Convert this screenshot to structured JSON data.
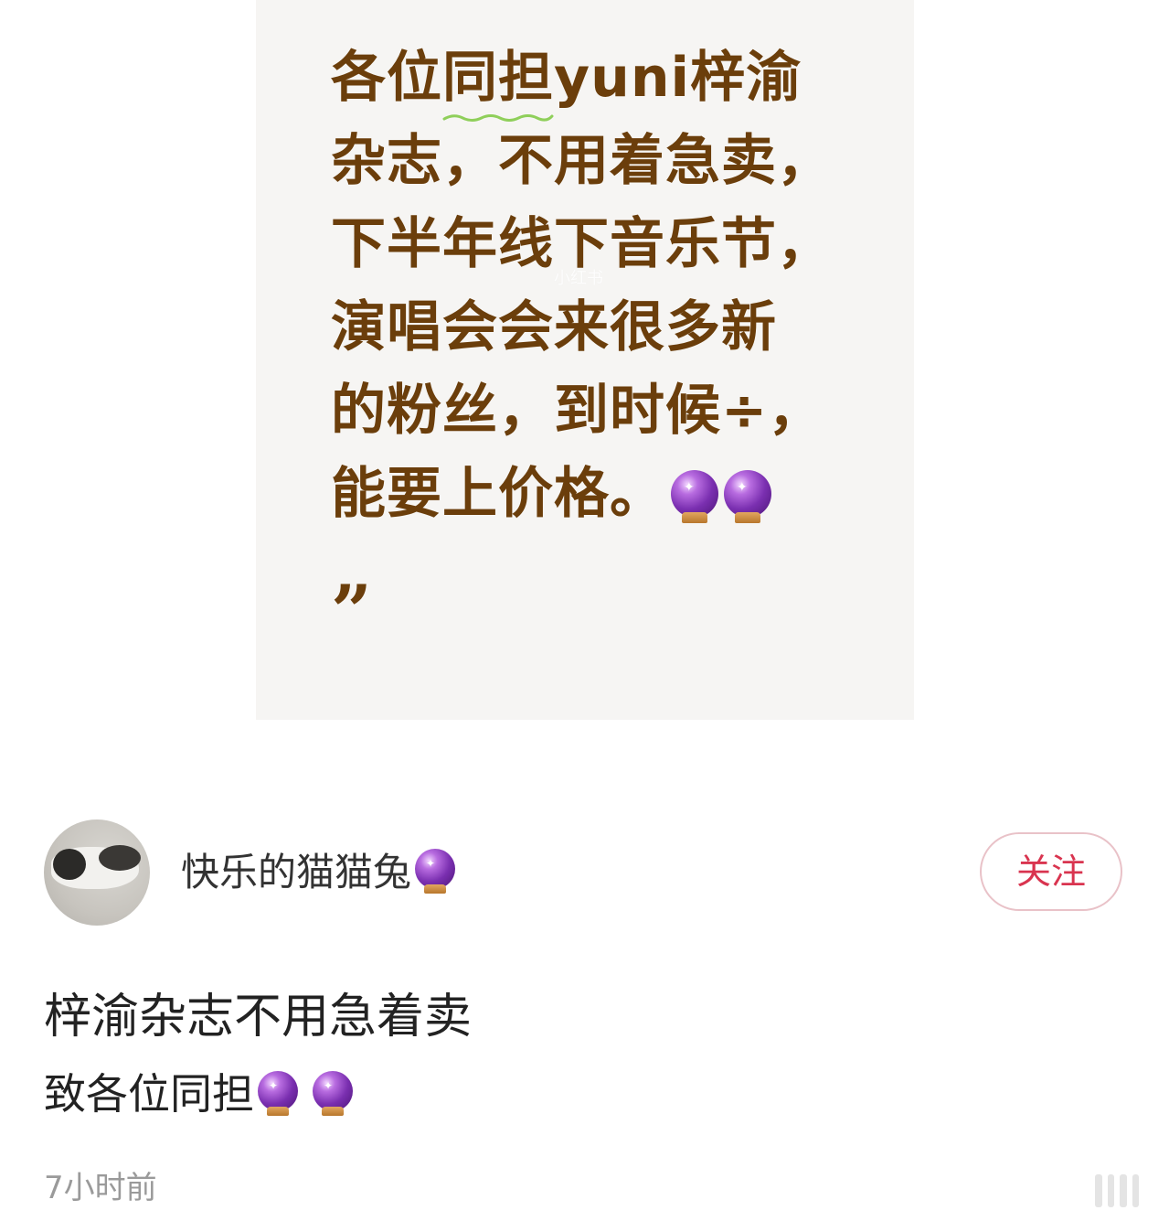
{
  "post_image": {
    "lines": [
      {
        "before": "各位",
        "underlined": "同担",
        "after": "yuni梓渝"
      },
      {
        "text": "杂志，不用着急卖，"
      },
      {
        "text": "下半年线下音乐节，"
      },
      {
        "text": "演唱会会来很多新"
      },
      {
        "text": "的粉丝，到时候÷，"
      },
      {
        "text": "能要上价格。",
        "icons": [
          "crystal-ball-icon",
          "crystal-ball-icon"
        ]
      }
    ],
    "closing_quote": "”",
    "watermark": "小红书"
  },
  "author": {
    "name": "快乐的猫猫兔",
    "name_icon": "crystal-ball-icon",
    "follow_label": "关注"
  },
  "post": {
    "title": "梓渝杂志不用急着卖",
    "description": "致各位同担",
    "description_icons": [
      "crystal-ball-icon",
      "crystal-ball-icon"
    ],
    "time": "7小时前"
  },
  "colors": {
    "quote_text": "#6b3e0b",
    "follow_accent": "#d9344f",
    "squiggle": "#8fcf5a",
    "card_bg": "#f6f5f3"
  }
}
